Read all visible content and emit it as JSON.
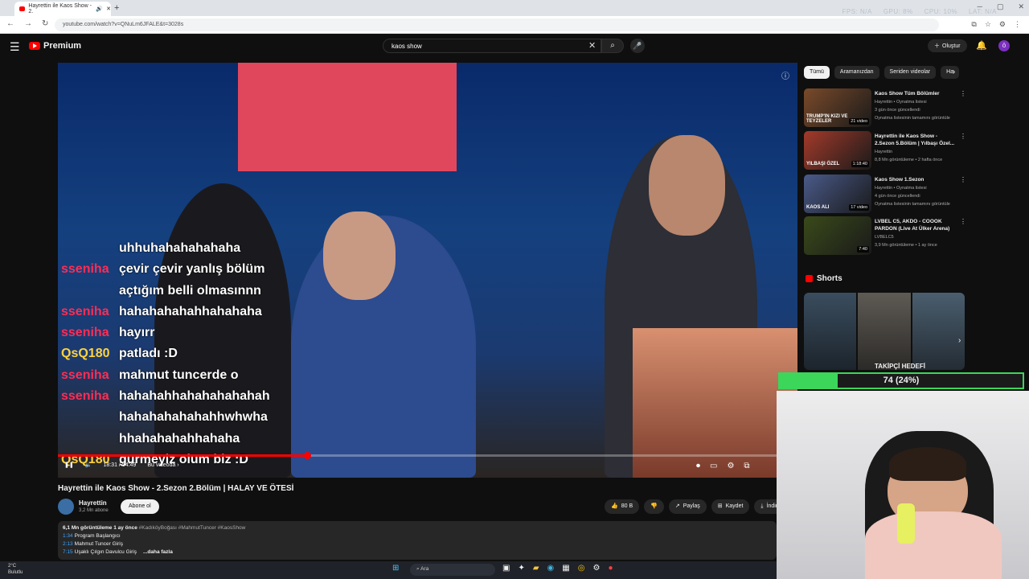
{
  "browser": {
    "tab_title": "Hayrettin ile Kaos Show - 2.",
    "new_tab": "+",
    "url": "youtube.com/watch?v=QNuLm6JFALE&t=3028s",
    "perf_overlay": [
      "FPS: N/A",
      "GPU: 8%",
      "CPU: 10%",
      "LAT: N/A"
    ]
  },
  "header": {
    "brand": "Premium",
    "search_value": "kaos show",
    "create_label": "Oluştur",
    "avatar_letter": "ö"
  },
  "chat": [
    {
      "name": "",
      "text": "uhhuhahahahahaha",
      "color": "#ff3333"
    },
    {
      "name": "sseniha",
      "text": "çevir çevir yanlış bölüm",
      "color": "#ff2d55"
    },
    {
      "name": "",
      "text": "açtığım belli olmasınnn",
      "color": "#ff2d55"
    },
    {
      "name": "sseniha",
      "text": "hahahahahahhahahaha",
      "color": "#ff2d55"
    },
    {
      "name": "sseniha",
      "text": "hayırr",
      "color": "#ff2d55"
    },
    {
      "name": "QsQ180",
      "text": "patladı :D",
      "color": "#ffd23f"
    },
    {
      "name": "sseniha",
      "text": "mahmut tuncerde o",
      "color": "#ff2d55"
    },
    {
      "name": "sseniha",
      "text": "hahahahhahahahahahah",
      "color": "#ff2d55"
    },
    {
      "name": "",
      "text": "hahahahahahahhwhwha",
      "color": "#ff2d55"
    },
    {
      "name": "",
      "text": "hhahahahahhahaha",
      "color": "#ff2d55"
    },
    {
      "name": "QsQ180",
      "text": "gurmeyiz olum biz :D",
      "color": "#ffd23f"
    }
  ],
  "player": {
    "time": "18:31 / 54:49",
    "chapter": "Bu videoda",
    "progress_fraction": 0.337
  },
  "video": {
    "title": "Hayrettin ile Kaos Show - 2.Sezon 2.Bölüm | HALAY VE ÖTESİ",
    "channel": "Hayrettin",
    "subscribers": "3,2 Mn abone",
    "subscribe_label": "Abone ol",
    "likes": "80 B",
    "share": "Paylaş",
    "save": "Kaydet",
    "download": "İndir",
    "desc_stats": "6,1 Mn görüntüleme  1 ay önce",
    "desc_tags": "#KadıköyBoğası #MahmutTuncer #KaosShow",
    "chapters": [
      {
        "t": "1:34",
        "label": "Program Başlangıcı"
      },
      {
        "t": "2:13",
        "label": "Mahmut Tuncer Giriş"
      },
      {
        "t": "7:15",
        "label": "Uşaklı Çılgın Davulcu Giriş"
      }
    ],
    "more": "...daha fazla"
  },
  "sidebar": {
    "chips": [
      "Tümü",
      "Aramanızdan",
      "Seriden videolar",
      "Ha"
    ],
    "items": [
      {
        "title": "Kaos Show Tüm Bölümler",
        "channel": "Hayrettin • Oynatma listesi",
        "meta": "3 gün önce güncellendi",
        "extra": "Oynatma listesinin tamamını görüntüle",
        "thumb_label": "TRUMP'IN KIZI VE TEYZELER",
        "badge": "21 video",
        "color": "#7a4a2a"
      },
      {
        "title": "Hayrettin ile Kaos Show - 2.Sezon 5.Bölüm | Yılbaşı Özel...",
        "channel": "Hayrettin",
        "meta": "8,8 Mn görüntüleme • 2 hafta önce",
        "extra": "",
        "thumb_label": "YILBAŞI ÖZEL",
        "badge": "1:18:40",
        "color": "#a33a2a"
      },
      {
        "title": "Kaos Show 1.Sezon",
        "channel": "Hayrettin • Oynatma listesi",
        "meta": "4 gün önce güncellendi",
        "extra": "Oynatma listesinin tamamını görüntüle",
        "thumb_label": "KAOS ALI",
        "badge": "17 video",
        "color": "#4a5a8a"
      },
      {
        "title": "LVBEL C5, AKDO - COOOK PARDON (Live At Ülker Arena)",
        "channel": "LVBELC5",
        "meta": "3,9 Mn görüntüleme • 1 ay önce",
        "extra": "",
        "thumb_label": "",
        "badge": "7:40",
        "color": "#3a4a1a"
      }
    ],
    "shorts_title": "Shorts",
    "shorts_label": "TAKİPÇİ HEDEFİ"
  },
  "stream": {
    "goal_text": "74 (24%)",
    "goal_fraction": 0.24
  },
  "taskbar": {
    "temp": "2°C",
    "weather": "Bulutlu",
    "search": "Ara"
  }
}
